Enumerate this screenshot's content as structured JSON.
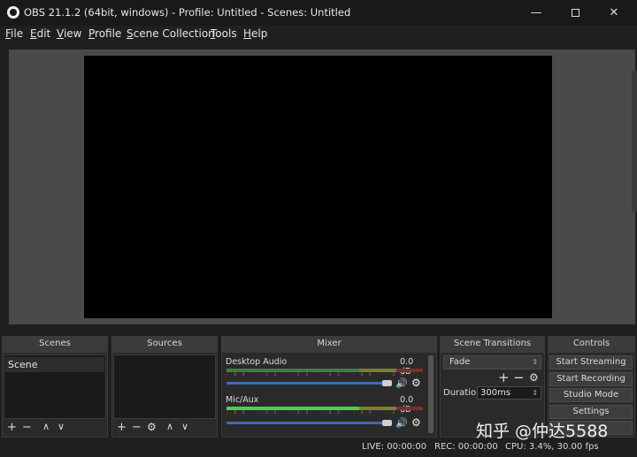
{
  "window": {
    "title": "OBS 21.1.2 (64bit, windows) - Profile: Untitled - Scenes: Untitled",
    "minimize_glyph": "—",
    "close_glyph": "✕"
  },
  "menu": [
    {
      "label_first": "F",
      "label_rest": "ile"
    },
    {
      "label_first": "E",
      "label_rest": "dit"
    },
    {
      "label_first": "V",
      "label_rest": "iew"
    },
    {
      "label_first": "P",
      "label_rest": "rofile"
    },
    {
      "label_first": "S",
      "label_rest": "cene Collection"
    },
    {
      "label_first": "T",
      "label_rest": "ools"
    },
    {
      "label_first": "H",
      "label_rest": "elp"
    }
  ],
  "docks": {
    "scenes": "Scenes",
    "sources": "Sources",
    "mixer": "Mixer",
    "transitions": "Scene Transitions",
    "controls": "Controls"
  },
  "scenes": {
    "items": [
      "Scene"
    ],
    "toolbar": {
      "add": "+",
      "remove": "−",
      "up": "∧",
      "down": "∨"
    }
  },
  "sources": {
    "toolbar": {
      "add": "+",
      "remove": "−",
      "settings": "⚙",
      "up": "∧",
      "down": "∨"
    }
  },
  "mixer": {
    "channels": [
      {
        "name": "Desktop Audio",
        "db": "0.0 dB",
        "level": 0.0
      },
      {
        "name": "Mic/Aux",
        "db": "0.0 dB",
        "level": 0.55
      }
    ],
    "ticks": "-60 -55 -50 -45 -40 -35 -30 -25 -20 -15 -10 -5 0",
    "volume_icon": "🔊",
    "settings_icon": "⚙"
  },
  "transitions": {
    "selected": "Fade",
    "add": "+",
    "remove": "−",
    "settings": "⚙",
    "duration_label": "Duration",
    "duration_value": "300ms",
    "spin_glyph": "⇕",
    "select_arrow": "⇕"
  },
  "controls": {
    "start_streaming": "Start Streaming",
    "start_recording": "Start Recording",
    "studio_mode": "Studio Mode",
    "settings": "Settings"
  },
  "status": {
    "live": "LIVE: 00:00:00",
    "rec": "REC: 00:00:00",
    "cpu": "CPU: 3.4%, 30.00 fps"
  },
  "watermark": "知乎 @仲达5588"
}
